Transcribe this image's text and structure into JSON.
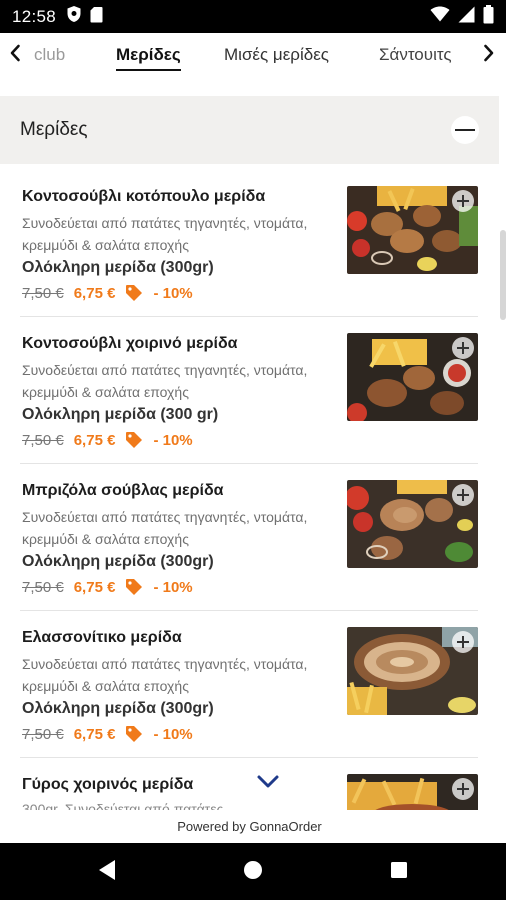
{
  "status_bar": {
    "time": "12:58",
    "left_icons": [
      "shield-icon",
      "sim-card-icon"
    ],
    "right_icons": [
      "wifi-icon",
      "signal-icon",
      "battery-icon"
    ]
  },
  "tabs": {
    "items": [
      {
        "label": "club",
        "active": false
      },
      {
        "label": "Μερίδες",
        "active": true
      },
      {
        "label": "Μισές μερίδες",
        "active": false
      },
      {
        "label": "Σάντουιτς",
        "active": false
      }
    ]
  },
  "section": {
    "title": "Μερίδες"
  },
  "menu_items": [
    {
      "name": "Κοντοσούβλι κοτόπουλο μερίδα",
      "description": "Συνοδεύεται από πατάτες τηγανητές, ντομάτα, κρεμμύδι & σαλάτα εποχής",
      "portion": "Ολόκληρη μερίδα (300gr)",
      "old_price": "7,50 €",
      "new_price": "6,75 €",
      "discount": "- 10%"
    },
    {
      "name": "Κοντοσούβλι χοιρινό μερίδα",
      "description": "Συνοδεύεται από πατάτες τηγανητές, ντομάτα, κρεμμύδι & σαλάτα εποχής",
      "portion": "Ολόκληρη μερίδα (300 gr)",
      "old_price": "7,50 €",
      "new_price": "6,75 €",
      "discount": "- 10%"
    },
    {
      "name": "Μπριζόλα σούβλας μερίδα",
      "description": "Συνοδεύεται από πατάτες τηγανητές, ντομάτα, κρεμμύδι & σαλάτα εποχής",
      "portion": "Ολόκληρη μερίδα (300gr)",
      "old_price": "7,50 €",
      "new_price": "6,75 €",
      "discount": "- 10%"
    },
    {
      "name": "Ελασσονίτικο μερίδα",
      "description": "Συνοδεύεται από πατάτες τηγανητές, ντομάτα, κρεμμύδι & σαλάτα εποχής",
      "portion": "Ολόκληρη μερίδα (300gr)",
      "old_price": "7,50 €",
      "new_price": "6,75 €",
      "discount": "- 10%"
    },
    {
      "name": "Γύρος χοιρινός μερίδα",
      "description": "300gr. Συνοδεύεται από πατάτες"
    }
  ],
  "footer": {
    "powered_by": "Powered by GonnaOrder"
  },
  "colors": {
    "accent": "#f07a1a",
    "section_bg": "#f1f0ee",
    "chevron": "#1f3a8a"
  },
  "nav_bar": {
    "icons": [
      "back-icon",
      "home-icon",
      "recents-icon"
    ]
  }
}
